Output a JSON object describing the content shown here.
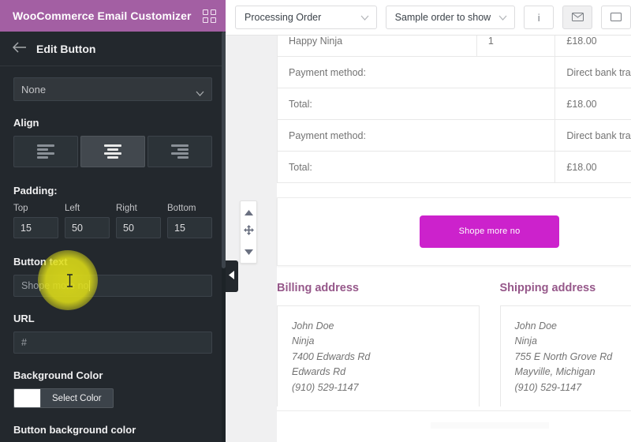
{
  "sidebar": {
    "app_title": "WooCommerce Email Customizer",
    "grid_icon": "grid-icon",
    "back_icon": "back-arrow-icon",
    "panel_title": "Edit Button",
    "element_select": {
      "value": "None",
      "icon": "chevron-down-icon"
    },
    "align": {
      "label": "Align",
      "options": [
        "align-left",
        "align-center",
        "align-right"
      ],
      "selected_index": 1
    },
    "padding": {
      "label": "Padding:",
      "fields": [
        {
          "label": "Top",
          "value": "15"
        },
        {
          "label": "Left",
          "value": "50"
        },
        {
          "label": "Right",
          "value": "50"
        },
        {
          "label": "Bottom",
          "value": "15"
        }
      ]
    },
    "button_text": {
      "label": "Button text",
      "value": "Shope more no"
    },
    "url": {
      "label": "URL",
      "value": "#"
    },
    "background_color": {
      "label": "Background Color",
      "button": "Select Color",
      "swatch": "#ffffff"
    },
    "button_background_color": {
      "label": "Button background color"
    },
    "collapse_icon": "collapse-left-icon"
  },
  "toolbar": {
    "email_type": {
      "value": "Processing Order",
      "icon": "chevron-down-icon"
    },
    "sample_order": {
      "value": "Sample order to show",
      "icon": "chevron-down-icon"
    },
    "info_button": {
      "icon": "info-icon",
      "glyph": "i"
    },
    "mail_button": {
      "icon": "envelope-icon"
    },
    "device_button": {
      "icon": "desktop-icon"
    }
  },
  "preview": {
    "order_table": {
      "rows": [
        {
          "a": "Happy Ninja",
          "b": "1",
          "c": "£18.00"
        },
        {
          "a": "Payment method:",
          "b": "",
          "c": "Direct bank transfer"
        },
        {
          "a": "Total:",
          "b": "",
          "c": "£18.00"
        },
        {
          "a": "Payment method:",
          "b": "",
          "c": "Direct bank transfer"
        },
        {
          "a": "Total:",
          "b": "",
          "c": "£18.00"
        }
      ]
    },
    "cta_button": {
      "label": "Shope more no",
      "color": "#cc22cc"
    },
    "drag_widget": {
      "up_icon": "arrow-up-icon",
      "move_icon": "move-icon",
      "down_icon": "arrow-down-icon"
    },
    "addresses": [
      {
        "heading": "Billing address",
        "lines": "John Doe\nNinja\n7400 Edwards Rd\nEdwards Rd\n(910) 529-1147"
      },
      {
        "heading": "Shipping address",
        "lines": "John Doe\nNinja\n755 E North Grove Rd\nMayville, Michigan\n(910) 529-1147"
      }
    ]
  },
  "colors": {
    "brand_purple": "#a35fa3",
    "sidebar_bg": "#23282d",
    "cta_magenta": "#cc22cc",
    "heading_purple": "#96588a",
    "click_highlight": "#dedd18"
  }
}
